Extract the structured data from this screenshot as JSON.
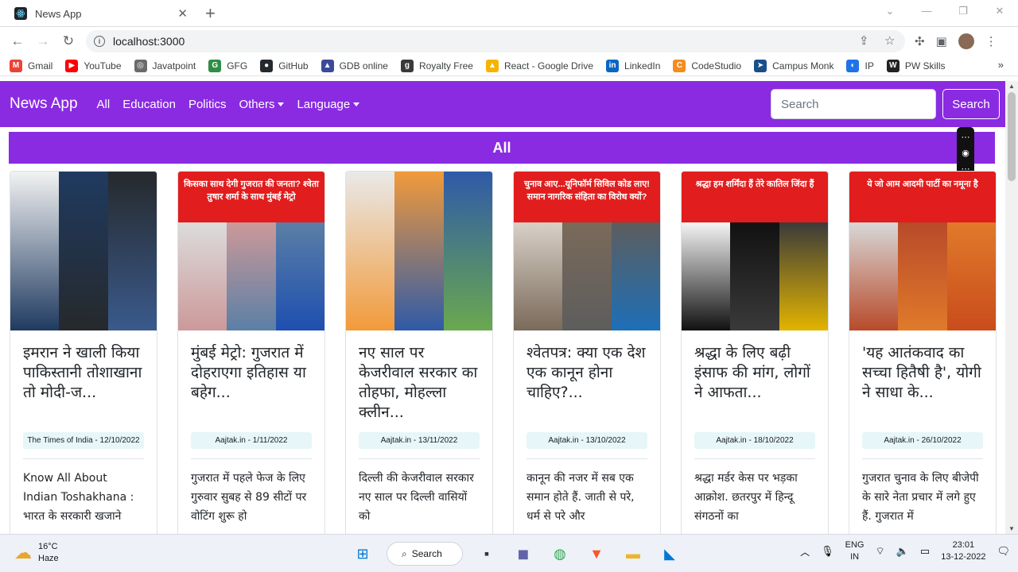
{
  "browser": {
    "tab_title": "News App",
    "url": "localhost:3000",
    "bookmarks": [
      {
        "label": "Gmail",
        "icon": "gmail-icon",
        "color": "#ea4335",
        "glyph": "M"
      },
      {
        "label": "YouTube",
        "icon": "youtube-icon",
        "color": "#ff0000",
        "glyph": "▶"
      },
      {
        "label": "Javatpoint",
        "icon": "globe-icon",
        "color": "#6b6b6b",
        "glyph": "◎"
      },
      {
        "label": "GFG",
        "icon": "gfg-icon",
        "color": "#2f8d46",
        "glyph": "G"
      },
      {
        "label": "GitHub",
        "icon": "github-icon",
        "color": "#24292e",
        "glyph": "●"
      },
      {
        "label": "GDB online",
        "icon": "gdb-icon",
        "color": "#3b4a9a",
        "glyph": "▲"
      },
      {
        "label": "Royalty Free",
        "icon": "royalty-free-icon",
        "color": "#3a3a3a",
        "glyph": "g"
      },
      {
        "label": "React - Google Drive",
        "icon": "google-drive-icon",
        "color": "#f4b400",
        "glyph": "▲"
      },
      {
        "label": "LinkedIn",
        "icon": "linkedin-icon",
        "color": "#0a66c2",
        "glyph": "in"
      },
      {
        "label": "CodeStudio",
        "icon": "codestudio-icon",
        "color": "#f68b1e",
        "glyph": "C"
      },
      {
        "label": "Campus Monk",
        "icon": "campus-monk-icon",
        "color": "#1a4f8a",
        "glyph": "➤"
      },
      {
        "label": "IP",
        "icon": "ip-icon",
        "color": "#1e73e8",
        "glyph": "◐"
      },
      {
        "label": "PW Skills",
        "icon": "pw-skills-icon",
        "color": "#222222",
        "glyph": "W"
      }
    ]
  },
  "navbar": {
    "brand": "News App",
    "links": [
      "All",
      "Education",
      "Politics"
    ],
    "dropdowns": [
      "Others",
      "Language"
    ],
    "search_placeholder": "Search",
    "search_button": "Search"
  },
  "page_heading": "All",
  "cards": [
    {
      "image_banner": "",
      "title": "इमरान ने खाली किया पाकिस्तानी तोशाखाना तो मोदी-ज...",
      "source": "The Times of India - 12/10/2022",
      "description": "Know All About Indian Toshakhana : भारत के सरकारी खजाने"
    },
    {
      "image_banner": "किसका साथ देगी गुजरात की जनता? श्वेता तुषार शर्मा के साथ मुंबई मेट्रो",
      "title": "मुंबई मेट्रो: गुजरात में दोहराएगा इतिहास या बहेग...",
      "source": "Aajtak.in - 1/11/2022",
      "description": "गुजरात में पहले फेज के लिए गुरुवार सुबह से 89 सीटों पर वोटिंग शुरू हो"
    },
    {
      "image_banner": "",
      "title": "नए साल पर केजरीवाल सरकार का तोहफा, मोहल्ला क्लीन...",
      "source": "Aajtak.in - 13/11/2022",
      "description": "दिल्ली की केजरीवाल सरकार नए साल पर दिल्ली वासियों को"
    },
    {
      "image_banner": "चुनाव आए...यूनिफॉर्म सिविल कोड लाए! समान नागरिक संहिता का विरोध क्यों?",
      "title": "श्वेतपत्र: क्या एक देश एक कानून होना चाहिए?...",
      "source": "Aajtak.in - 13/10/2022",
      "description": "कानून की नजर में सब एक समान होते हैं. जाती से परे, धर्म से परे और"
    },
    {
      "image_banner": "श्रद्धा हम शर्मिंदा हैं तेरे कातिल जिंदा हैं",
      "title": "श्रद्धा के लिए बढ़ी इंसाफ की मांग, लोगों ने आफता...",
      "source": "Aajtak.in - 18/10/2022",
      "description": "श्रद्धा मर्डर केस पर भड़का आक्रोश. छतरपुर में हिन्दू संगठनों का"
    },
    {
      "image_banner": "ये जो आम आदमी पार्टी का नमूना है",
      "title": "'यह आतंकवाद का सच्चा हितैषी है', योगी ने साधा के...",
      "source": "Aajtak.in - 26/10/2022",
      "description": "गुजरात चुनाव के लिए बीजेपी के सारे नेता प्रचार में लगे हुए हैं. गुजरात में"
    }
  ],
  "taskbar": {
    "temperature": "16°C",
    "weather": "Haze",
    "search_label": "Search",
    "language": "ENG",
    "region": "IN",
    "time": "23:01",
    "date": "13-12-2022"
  },
  "colors": {
    "brand_purple": "#8a2be2",
    "badge_bg": "#e7f6f8",
    "thumb_red": "#e11d1d"
  }
}
